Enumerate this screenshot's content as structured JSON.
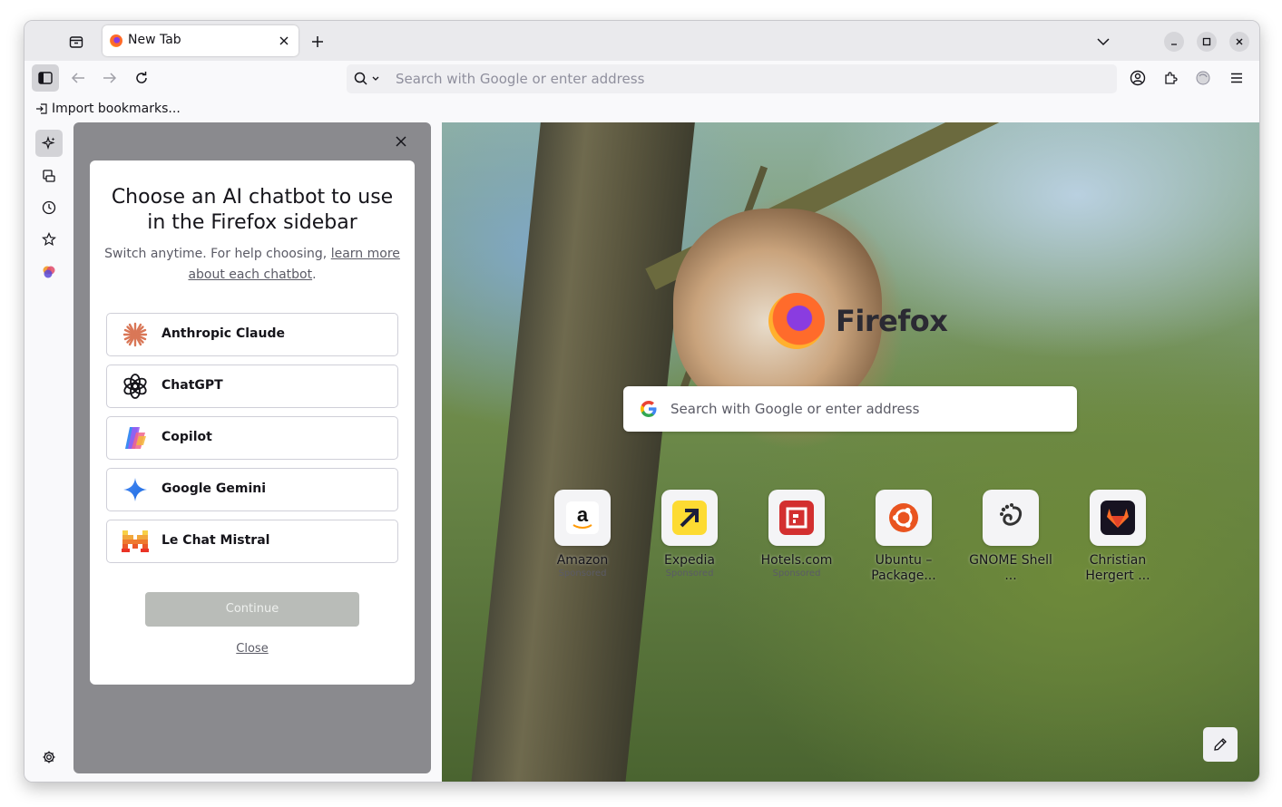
{
  "tabs": [
    {
      "title": "New Tab"
    }
  ],
  "urlbar": {
    "placeholder": "Search with Google or enter address"
  },
  "bookmarks_toolbar": {
    "import_label": "Import bookmarks..."
  },
  "sidebar_panel": {
    "title": "Choose an AI chatbot to use in the Firefox sidebar",
    "title_line1": "Choose an AI chatbot to use",
    "title_line2": "in the Firefox sidebar",
    "subtitle_prefix": "Switch anytime. For help choosing,",
    "subtitle_link_1": "learn more",
    "subtitle_link_2": "about each chatbot",
    "subtitle_suffix": ".",
    "chatbots": [
      {
        "name": "Anthropic Claude",
        "icon": "claude-icon"
      },
      {
        "name": "ChatGPT",
        "icon": "chatgpt-icon"
      },
      {
        "name": "Copilot",
        "icon": "copilot-icon"
      },
      {
        "name": "Google Gemini",
        "icon": "gemini-icon"
      },
      {
        "name": "Le Chat Mistral",
        "icon": "mistral-icon"
      }
    ],
    "continue_label": "Continue",
    "close_label": "Close"
  },
  "newtab": {
    "brand": "Firefox",
    "search_placeholder": "Search with Google or enter address",
    "top_sites": [
      {
        "label": "Amazon",
        "sponsored": "Sponsored",
        "icon": "amazon-icon"
      },
      {
        "label": "Expedia",
        "sponsored": "Sponsored",
        "icon": "expedia-icon"
      },
      {
        "label": "Hotels.com",
        "sponsored": "Sponsored",
        "icon": "hotels-icon"
      },
      {
        "label": "Ubuntu – Package...",
        "icon": "ubuntu-icon"
      },
      {
        "label": "GNOME Shell ...",
        "icon": "gnome-icon"
      },
      {
        "label": "Christian Hergert ...",
        "icon": "gitlab-icon"
      }
    ]
  },
  "colors": {
    "accent": "#0061e0",
    "panel_bg": "#8a8a8e",
    "continue_disabled": "#b9bcb8"
  }
}
